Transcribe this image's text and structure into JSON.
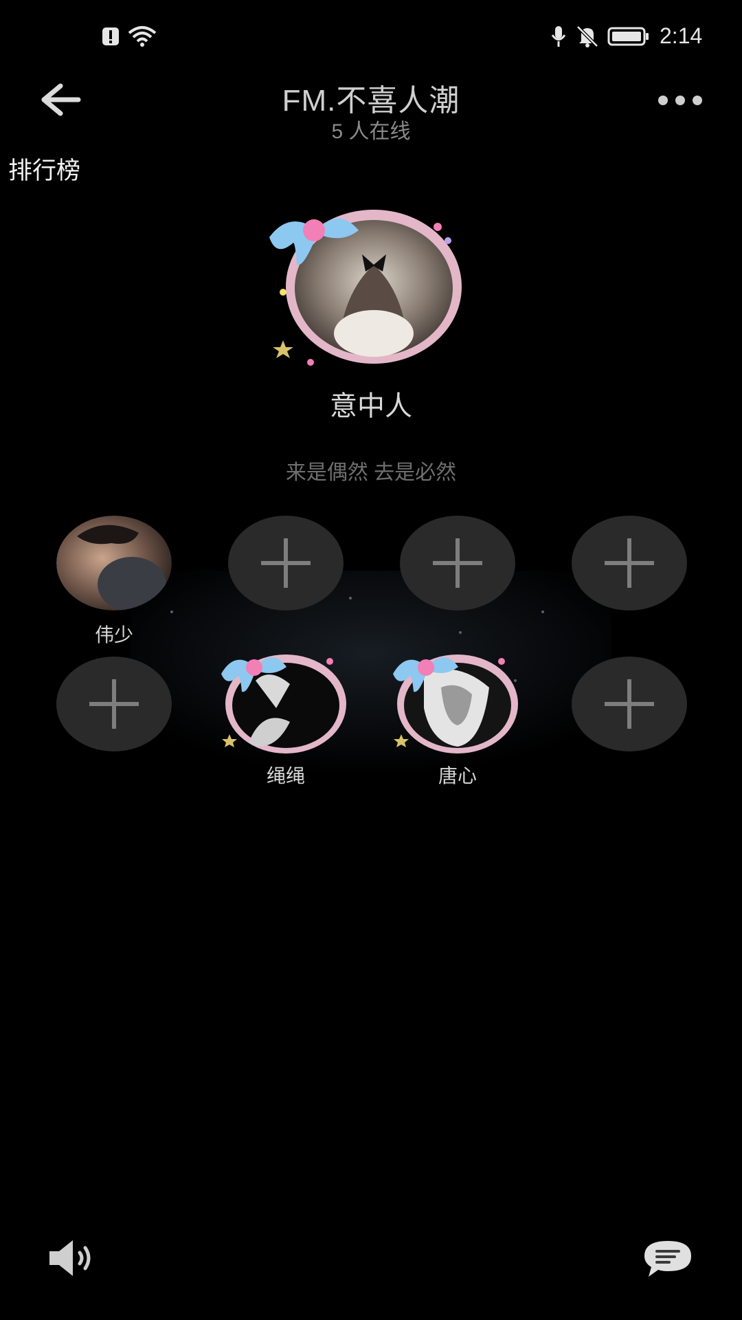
{
  "status_bar": {
    "time": "2:14",
    "icons": [
      "alert-icon",
      "wifi-icon",
      "mic-icon",
      "bell-off-icon",
      "battery-icon"
    ]
  },
  "header": {
    "title": "FM.不喜人潮",
    "online": "5 人在线",
    "icons": [
      "back-arrow-icon",
      "more-icon"
    ]
  },
  "ranking": {
    "label": "排行榜"
  },
  "host": {
    "name": "意中人",
    "motto": "来是偶然 去是必然"
  },
  "seats": [
    {
      "name": "伟少",
      "occupied": true
    },
    {
      "name": "",
      "occupied": false
    },
    {
      "name": "",
      "occupied": false
    },
    {
      "name": "",
      "occupied": false
    },
    {
      "name": "",
      "occupied": false
    },
    {
      "name": "绳绳",
      "occupied": true
    },
    {
      "name": "唐心",
      "occupied": true
    },
    {
      "name": "",
      "occupied": false
    }
  ],
  "bottom": {
    "icons": [
      "speaker-icon",
      "chat-icon"
    ]
  },
  "colors": {
    "background": "#000000",
    "seat_empty": "#2a2a2a",
    "text": "#d6d6d6",
    "muted": "#6f6f6f"
  }
}
